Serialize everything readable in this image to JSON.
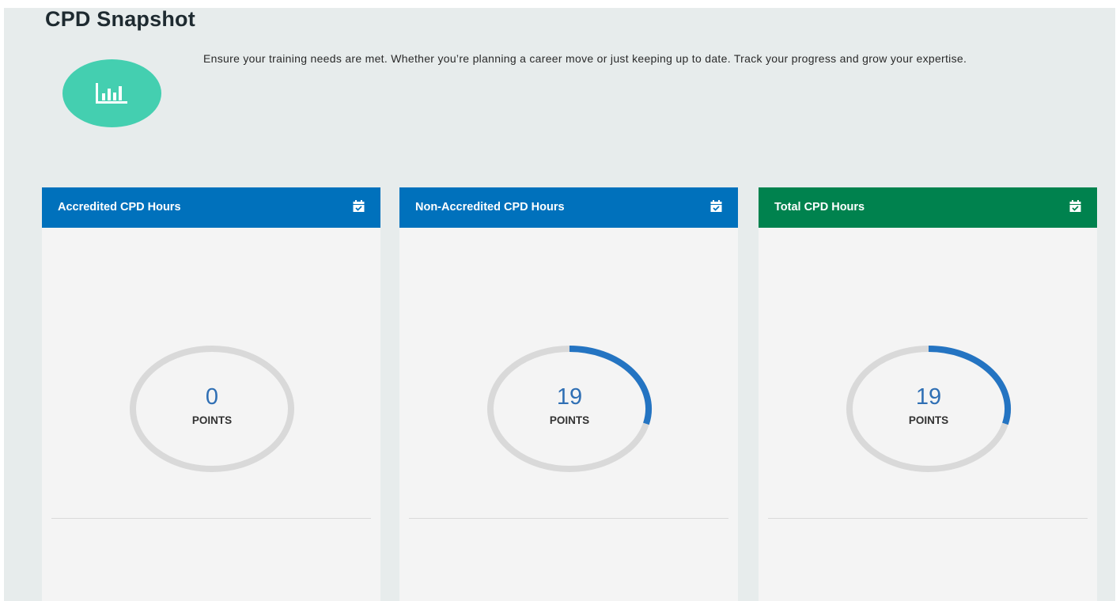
{
  "header": {
    "title": "CPD Snapshot",
    "description": "Ensure your training needs are met. Whether you’re planning a career move or just keeping up to date. Track your progress and grow your expertise.",
    "icon": "bar-chart-icon",
    "icon_bg": "#44cfb0"
  },
  "cards": [
    {
      "title": "Accredited CPD Hours",
      "value": "0",
      "unit": "POINTS",
      "progress": 0.0,
      "header_color": "#0071bc",
      "icon": "calendar-check-icon"
    },
    {
      "title": "Non-Accredited CPD Hours",
      "value": "19",
      "unit": "POINTS",
      "progress": 0.29,
      "header_color": "#0071bc",
      "icon": "calendar-check-icon"
    },
    {
      "title": "Total CPD Hours",
      "value": "19",
      "unit": "POINTS",
      "progress": 0.29,
      "header_color": "#00824e",
      "icon": "calendar-check-icon"
    }
  ],
  "colors": {
    "ring_track": "#d9d9d9",
    "ring_progress": "#2474c2",
    "value_text": "#2f6fb4"
  }
}
